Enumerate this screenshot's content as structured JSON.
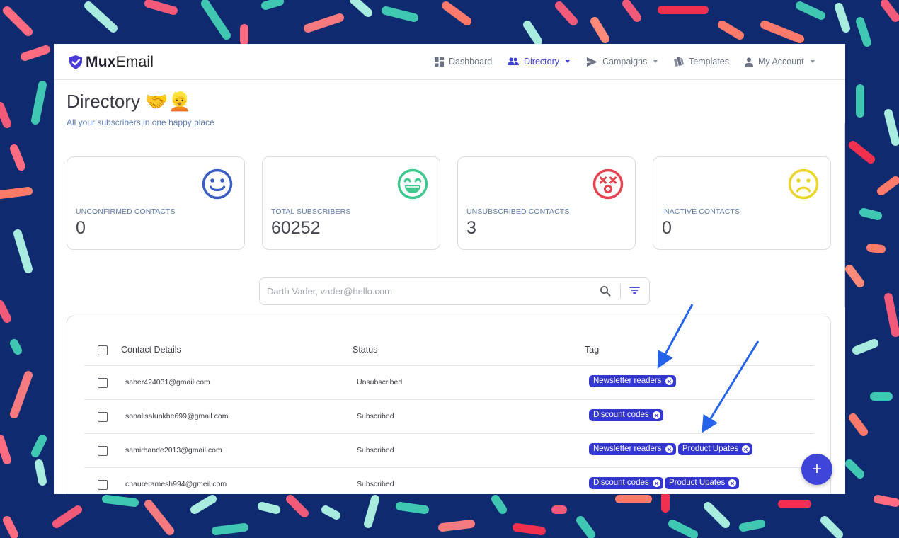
{
  "app": {
    "logo_bold": "Mux",
    "logo_rest": "Email"
  },
  "nav": [
    {
      "label": "Dashboard",
      "icon": "dashboard-icon"
    },
    {
      "label": "Directory",
      "icon": "people-icon",
      "active": true
    },
    {
      "label": "Campaigns",
      "icon": "send-icon"
    },
    {
      "label": "Templates",
      "icon": "templates-icon"
    },
    {
      "label": "My Account",
      "icon": "person-icon"
    }
  ],
  "page": {
    "title": "Directory 🤝👱",
    "subtitle": "All your subscribers in one happy place"
  },
  "stats": [
    {
      "label": "UNCONFIRMED CONTACTS",
      "value": "0",
      "icon": "smile-face-icon",
      "color": "#3b5ec4"
    },
    {
      "label": "TOTAL SUBSCRIBERS",
      "value": "60252",
      "icon": "grin-face-icon",
      "color": "#3fc98f"
    },
    {
      "label": "UNSUBSCRIBED CONTACTS",
      "value": "3",
      "icon": "dizzy-face-icon",
      "color": "#e2454f"
    },
    {
      "label": "INACTIVE CONTACTS",
      "value": "0",
      "icon": "sad-face-icon",
      "color": "#ecd52c"
    }
  ],
  "search": {
    "placeholder": "Darth Vader, vader@hello.com",
    "value": ""
  },
  "table": {
    "headers": {
      "contact": "Contact Details",
      "status": "Status",
      "tag": "Tag"
    },
    "rows": [
      {
        "email": "saber424031@gmail.com",
        "status": "Unsubscribed",
        "tags": [
          "Newsletter readers"
        ]
      },
      {
        "email": "sonalisalunkhe699@gmail.com",
        "status": "Subscribed",
        "tags": [
          "Discount codes"
        ]
      },
      {
        "email": "samirhande2013@gmail.com",
        "status": "Subscribed",
        "tags": [
          "Newsletter readers",
          "Product Upates"
        ]
      },
      {
        "email": "chaureramesh994@gmeil.com",
        "status": "Subscribed",
        "tags": [
          "Discount codes",
          "Product Upates"
        ]
      }
    ]
  },
  "fab": {
    "label": "+"
  },
  "colors": {
    "accent": "#3c3fd1",
    "tag_bg": "#3437cf",
    "backdrop": "#0f2a6e",
    "arrow": "#2563eb"
  }
}
